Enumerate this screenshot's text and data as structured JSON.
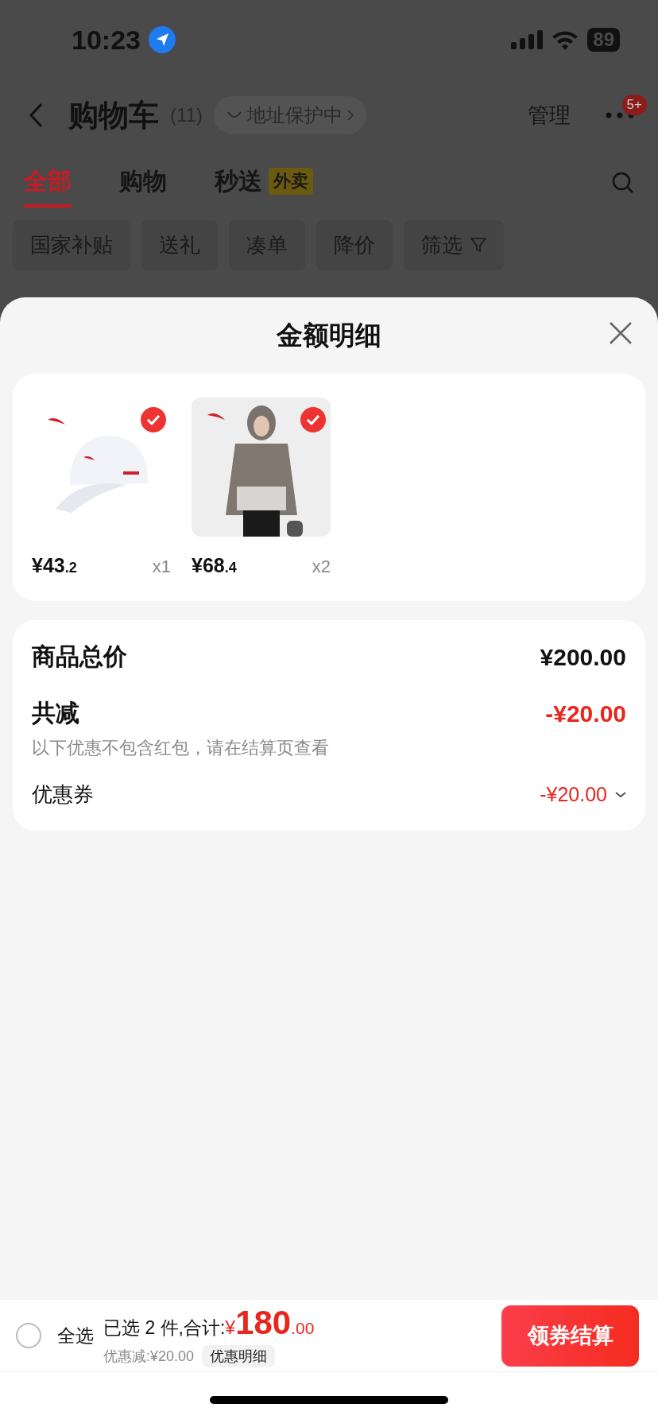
{
  "status_bar": {
    "time": "10:23",
    "battery": "89"
  },
  "header": {
    "title": "购物车",
    "count": "(11)",
    "address_pill": "地址保护中",
    "manage": "管理",
    "badge": "5+"
  },
  "tabs": [
    {
      "label": "全部",
      "selected": true
    },
    {
      "label": "购物",
      "selected": false
    },
    {
      "label": "秒送",
      "selected": false,
      "tag": "外卖"
    }
  ],
  "filters": [
    {
      "label": "国家补贴"
    },
    {
      "label": "送礼"
    },
    {
      "label": "凑单"
    },
    {
      "label": "降价"
    },
    {
      "label": "筛选",
      "kind": "dropdown"
    }
  ],
  "sheet": {
    "title": "金额明细",
    "products": [
      {
        "kind": "cap",
        "checked": true,
        "price": "¥43",
        "price_decimal": ".2",
        "quantity": "x1"
      },
      {
        "kind": "jacket",
        "checked": true,
        "price": "¥68",
        "price_decimal": ".4",
        "quantity": "x2"
      }
    ],
    "summary": {
      "total_label": "商品总价",
      "total": "¥200.00",
      "discount_label": "共减",
      "discount": "-¥20.00",
      "note": "以下优惠不包含红包，请在结算页查看",
      "coupon_label": "优惠券",
      "coupon": "-¥20.00"
    }
  },
  "bottom_bar": {
    "select_all": {
      "label": "全选",
      "selected": false
    },
    "selected_text": "已选 2 件,合计:",
    "currency": "¥",
    "total": "180",
    "total_decimal": ".00",
    "saving": "优惠减:¥20.00",
    "details_button": "优惠明细",
    "checkout_button": "领券结算"
  }
}
